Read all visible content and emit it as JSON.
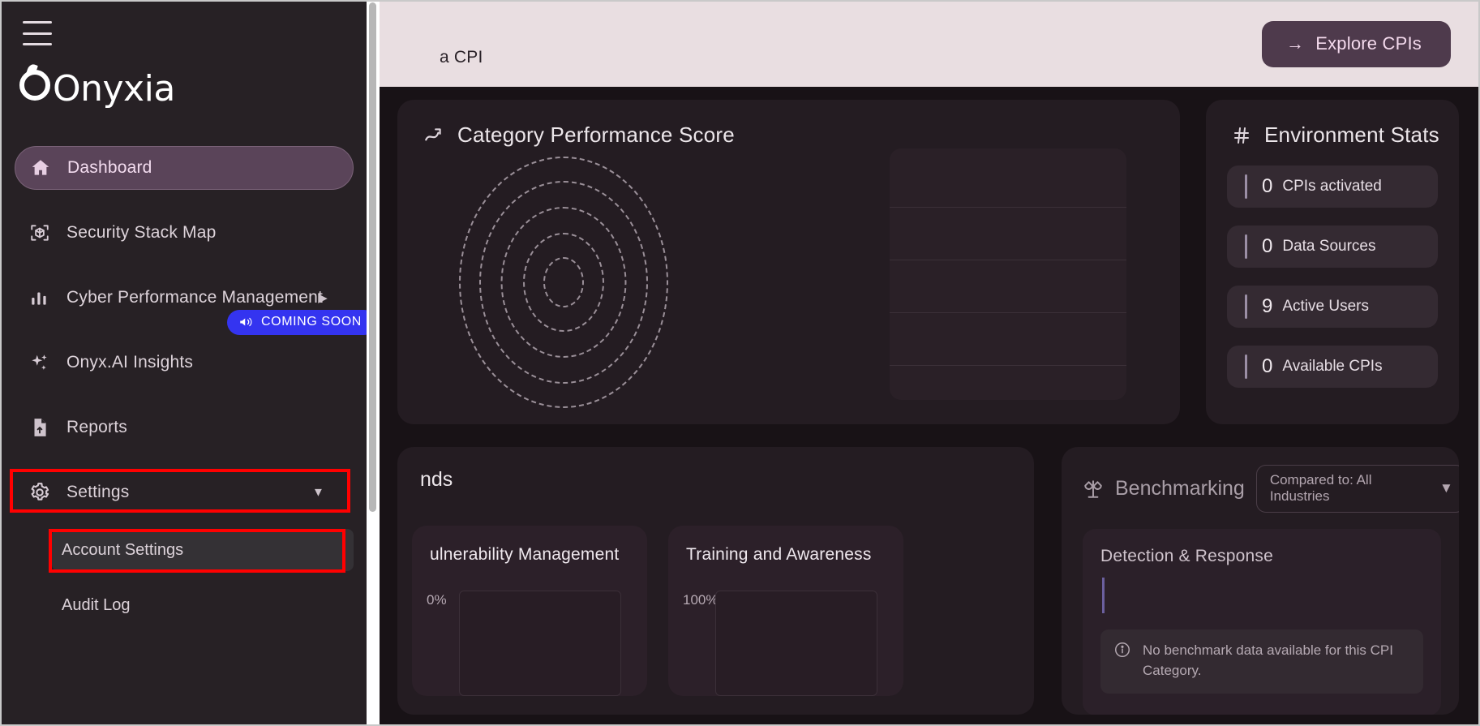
{
  "sidebar": {
    "brand": "Onyxia",
    "menu_icon": "hamburger-icon",
    "items": [
      {
        "label": "Dashboard",
        "icon": "home-icon",
        "active": true
      },
      {
        "label": "Security Stack Map",
        "icon": "cube-scan-icon",
        "active": false
      },
      {
        "label": "Cyber Performance Management",
        "icon": "bar-chart-icon",
        "active": false,
        "chevron": "▶"
      },
      {
        "label": "Onyx.AI Insights",
        "icon": "sparkles-icon",
        "active": false,
        "badge": "COMING SOON",
        "badge_icon": "megaphone-icon"
      },
      {
        "label": "Reports",
        "icon": "file-upload-icon",
        "active": false
      },
      {
        "label": "Settings",
        "icon": "gear-icon",
        "active": false,
        "chevron": "▼",
        "highlighted": true
      }
    ],
    "sub_items": [
      {
        "label": "Account Settings",
        "highlighted": true
      },
      {
        "label": "Audit Log",
        "highlighted": false
      }
    ]
  },
  "top_banner": {
    "subtext": "a CPI",
    "explore_button": "Explore CPIs",
    "explore_arrow": "→"
  },
  "category_card": {
    "title": "Category Performance Score",
    "icon": "trend-line-icon"
  },
  "environment_card": {
    "title": "Environment Stats",
    "icon": "hash-icon",
    "stats": [
      {
        "value": "0",
        "label": "CPIs activated"
      },
      {
        "value": "0",
        "label": "Data Sources"
      },
      {
        "value": "9",
        "label": "Active Users"
      },
      {
        "value": "0",
        "label": "Available CPIs"
      }
    ]
  },
  "trends_card": {
    "title": "nds",
    "mini_cards": [
      {
        "title": "ulnerability Management",
        "axis_label": "0%"
      },
      {
        "title": "Training and Awareness",
        "axis_label": "100%"
      }
    ]
  },
  "benchmarking_card": {
    "title": "Benchmarking",
    "icon": "scales-icon",
    "select_value": "Compared to: All Industries",
    "select_caret": "▼",
    "category_label": "Detection & Response",
    "note_icon": "info-icon",
    "note_text": "No benchmark data available for this CPI Category."
  },
  "colors": {
    "accent_purple": "#5a4459",
    "badge_blue": "#3434f0",
    "highlight_red": "#ff0000",
    "banner_pink": "#e9dee1",
    "card_bg": "#241c22"
  },
  "chart_data": {
    "type": "line",
    "title": "Category Performance Score",
    "categories": [],
    "values": [],
    "xlabel": "",
    "ylabel": "",
    "grid": true,
    "note": "empty radar / no data plotted"
  }
}
